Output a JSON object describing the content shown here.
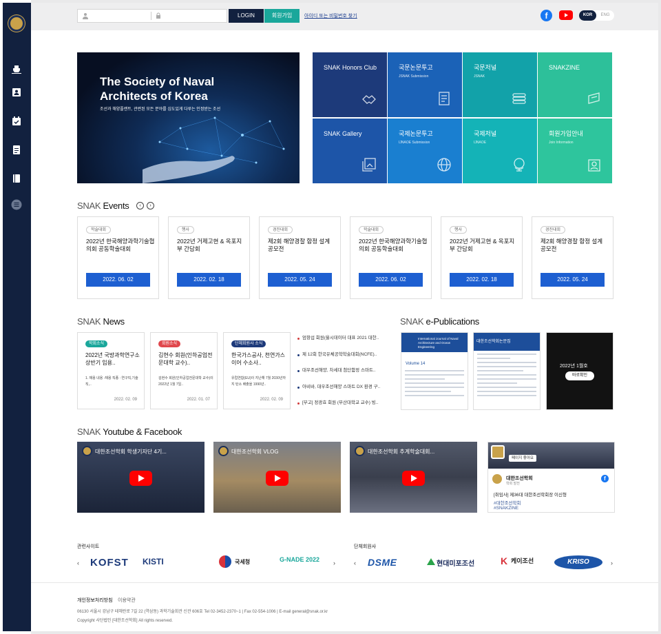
{
  "topbar": {
    "login_label": "LOGIN",
    "join_label": "회원가입",
    "find_label": "아이디 또는 비밀번호 찾기",
    "lang_kor": "KOR",
    "lang_eng": "ENG"
  },
  "hero": {
    "title": "The Society of Naval Architects of Korea",
    "subtitle": "조선과 해양플랜트, 관련된 모든 분야를 심도있게 다루는 인정받는 조선"
  },
  "tiles": [
    {
      "title": "SNAK Honors Club",
      "sub": "",
      "color": "#1d3a7a",
      "icon": "handshake-icon"
    },
    {
      "title": "국문논문투고",
      "sub": "JSNAK Submission",
      "color": "#1b62b7",
      "icon": "document-icon"
    },
    {
      "title": "국문저널",
      "sub": "JSNAK",
      "color": "#12a2a9",
      "icon": "books-icon"
    },
    {
      "title": "SNAKZINE",
      "sub": "",
      "color": "#2dc09a",
      "icon": "magazine-icon"
    },
    {
      "title": "SNAK Gallery",
      "sub": "",
      "color": "#1d55a8",
      "icon": "gallery-icon"
    },
    {
      "title": "국제논문투고",
      "sub": "IJNAOE Submission",
      "color": "#1a7fd0",
      "icon": "globe-icon"
    },
    {
      "title": "국제저널",
      "sub": "IJNAOE",
      "color": "#14b3b7",
      "icon": "globe-stand-icon"
    },
    {
      "title": "회원가입안내",
      "sub": "Join Information",
      "color": "#2ec59d",
      "icon": "id-card-icon"
    }
  ],
  "events": {
    "title_bold": "Events",
    "title_thin": "SNAK",
    "items": [
      {
        "badge": "학술대회",
        "title": "2022년 한국해양과학기술협의회 공동학술대회",
        "date": "2022. 06. 02"
      },
      {
        "badge": "행사",
        "title": "2022년 거제고현 & 옥포지부 간담회",
        "date": "2022. 02. 18"
      },
      {
        "badge": "경진대회",
        "title": "제2회 해양경찰 함정 설계 공모전",
        "date": "2022. 05. 24"
      },
      {
        "badge": "학술대회",
        "title": "2022년 한국해양과학기술협의회 공동학술대회",
        "date": "2022. 06. 02"
      },
      {
        "badge": "행사",
        "title": "2022년 거제고현 & 옥포지부 간담회",
        "date": "2022. 02. 18"
      },
      {
        "badge": "경진대회",
        "title": "제2회 해양경찰 함정 설계 공모전",
        "date": "2022. 05. 24"
      }
    ]
  },
  "news": {
    "title_thin": "SNAK",
    "title_bold": "News",
    "cards": [
      {
        "badge": "학회소식",
        "badge_color": "#1aa79b",
        "title": "2022년 국방과학연구소 상반기 임용..",
        "desc": "1. 채용 내용 -채용 직종 : 연구직,기술직,..",
        "date": "2022. 02. 09"
      },
      {
        "badge": "회원소식",
        "badge_color": "#e0474c",
        "title": "김현수 회원(인하공업전문대학 교수)..",
        "desc": "김현수 회원(인하공업전문대학 교수)이 2022년 1월 7일..",
        "date": "2022. 01. 07"
      },
      {
        "badge": "단체회원사 소식",
        "badge_color": "#1d3a7a",
        "title": "한국가스공사, 천연가스 이어 수소사..",
        "desc": "유럽연합(EU)이 지난해 7월 2030년까지 탄소 배출을 1990년..",
        "date": "2022. 02. 09"
      }
    ],
    "list": [
      {
        "text": "엄항섭 회원(울시데이터 대표 2021 대한..",
        "style": "red"
      },
      {
        "text": "제 12회 한국유체공학학술대회(NCFE)..",
        "style": "blue"
      },
      {
        "text": "대우조선해양, 차세대 첨단함정 스마트..",
        "style": "blue"
      },
      {
        "text": "아비바, 대우조선해양 스마트 DX 환경 구..",
        "style": "blue"
      },
      {
        "text": "[부고] 정광효 회원 (부산대학교 교수) 빙..",
        "style": "red"
      }
    ]
  },
  "epub": {
    "title_thin": "SNAK",
    "title_bold": "e-Publications",
    "pub1_head": "International Journal of Naval Architecture and Ocean Engineering",
    "pub1_vol": "Volume 14",
    "pub2_head": "대한조선학회논문집",
    "pub3_date": "2022년 1월호",
    "pub3_button": "바로확인"
  },
  "media": {
    "title_thin": "SNAK",
    "title_bold": "Youtube & Facebook",
    "videos": [
      {
        "title": "대한조선학회 학생기자단 4기..."
      },
      {
        "title": "대한조선학회 VLOG"
      },
      {
        "title": "대한조선학회 추계학술대회..."
      }
    ],
    "fb_page_name": "대한조선학회",
    "fb_like": "페이지 좋아요",
    "fb_sub": "학회 발전",
    "fb_post": "[취임사] 제36대 대한조선학회장 이신형",
    "fb_tag1": "#대한조선학회",
    "fb_tag2": "#SNAKZINE"
  },
  "partners": {
    "related_label": "관련사이트",
    "member_label": "단체회원사",
    "related": [
      "KOFST",
      "KISTI",
      "국세청",
      "G-NADE 2022"
    ],
    "members": [
      "DSME",
      "현대미포조선",
      "케이조선",
      "KRISO"
    ]
  },
  "footer": {
    "privacy": "개인정보처리방침",
    "terms": "이용약관",
    "address": "06130 서울시 강남구 테헤란로 7길 22 (역삼동) 과학기술회관 신관 606호   Tel 02-3452-2370~1 | Fax 02-554-1006 | E-mail general@snak.or.kr",
    "copyright": "Copyright 사단법인 [대한조선학회] All rights reserved."
  }
}
